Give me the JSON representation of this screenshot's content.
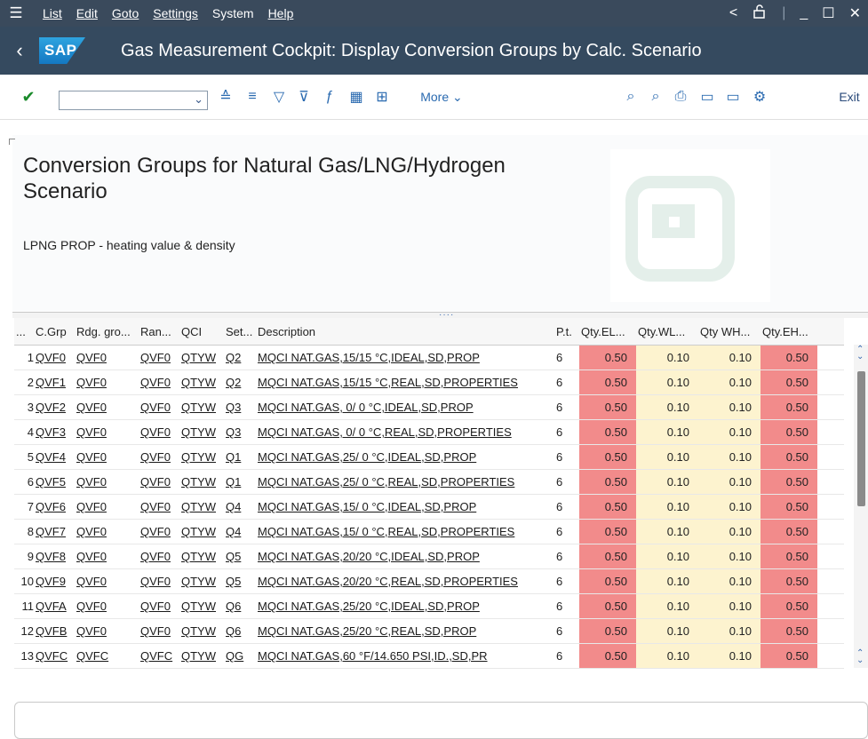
{
  "menubar": {
    "items": [
      "List",
      "Edit",
      "Goto",
      "Settings",
      "System",
      "Help"
    ]
  },
  "title": "Gas Measurement Cockpit: Display Conversion Groups by Calc. Scenario",
  "logo_text": "SAP",
  "toolbar": {
    "more_label": "More",
    "exit_label": "Exit"
  },
  "content": {
    "heading": "Conversion Groups for Natural Gas/LNG/Hydrogen Scenario",
    "subheading": "LPNG PROP - heating value & density"
  },
  "table": {
    "columns": [
      "...",
      "C.Grp",
      "Rdg. gro...",
      "Ran...",
      "QCI",
      "Set...",
      "Description",
      "P.t.",
      "Qty.EL...",
      "Qty.WL...",
      "Qty WH...",
      "Qty.EH..."
    ],
    "rows": [
      {
        "n": "1",
        "grp": "QVF0",
        "rdg": "QVF0",
        "ran": "QVF0",
        "qci": "QTYW",
        "set": "Q2",
        "desc": "MQCI NAT.GAS,15/15 °C,IDEAL,SD,PROP",
        "pt": "6",
        "el": "0.50",
        "wl": "0.10",
        "wh": "0.10",
        "eh": "0.50"
      },
      {
        "n": "2",
        "grp": "QVF1",
        "rdg": "QVF0",
        "ran": "QVF0",
        "qci": "QTYW",
        "set": "Q2",
        "desc": "MQCI NAT.GAS,15/15 °C,REAL,SD,PROPERTIES",
        "pt": "6",
        "el": "0.50",
        "wl": "0.10",
        "wh": "0.10",
        "eh": "0.50"
      },
      {
        "n": "3",
        "grp": "QVF2",
        "rdg": "QVF0",
        "ran": "QVF0",
        "qci": "QTYW",
        "set": "Q3",
        "desc": "MQCI NAT.GAS, 0/ 0 °C,IDEAL,SD,PROP",
        "pt": "6",
        "el": "0.50",
        "wl": "0.10",
        "wh": "0.10",
        "eh": "0.50"
      },
      {
        "n": "4",
        "grp": "QVF3",
        "rdg": "QVF0",
        "ran": "QVF0",
        "qci": "QTYW",
        "set": "Q3",
        "desc": "MQCI NAT.GAS, 0/ 0 °C,REAL,SD,PROPERTIES",
        "pt": "6",
        "el": "0.50",
        "wl": "0.10",
        "wh": "0.10",
        "eh": "0.50"
      },
      {
        "n": "5",
        "grp": "QVF4",
        "rdg": "QVF0",
        "ran": "QVF0",
        "qci": "QTYW",
        "set": "Q1",
        "desc": "MQCI NAT.GAS,25/ 0 °C,IDEAL,SD,PROP",
        "pt": "6",
        "el": "0.50",
        "wl": "0.10",
        "wh": "0.10",
        "eh": "0.50"
      },
      {
        "n": "6",
        "grp": "QVF5",
        "rdg": "QVF0",
        "ran": "QVF0",
        "qci": "QTYW",
        "set": "Q1",
        "desc": "MQCI NAT.GAS,25/ 0 °C,REAL,SD,PROPERTIES",
        "pt": "6",
        "el": "0.50",
        "wl": "0.10",
        "wh": "0.10",
        "eh": "0.50"
      },
      {
        "n": "7",
        "grp": "QVF6",
        "rdg": "QVF0",
        "ran": "QVF0",
        "qci": "QTYW",
        "set": "Q4",
        "desc": "MQCI NAT.GAS,15/ 0 °C,IDEAL,SD,PROP",
        "pt": "6",
        "el": "0.50",
        "wl": "0.10",
        "wh": "0.10",
        "eh": "0.50"
      },
      {
        "n": "8",
        "grp": "QVF7",
        "rdg": "QVF0",
        "ran": "QVF0",
        "qci": "QTYW",
        "set": "Q4",
        "desc": "MQCI NAT.GAS,15/ 0 °C,REAL,SD,PROPERTIES",
        "pt": "6",
        "el": "0.50",
        "wl": "0.10",
        "wh": "0.10",
        "eh": "0.50"
      },
      {
        "n": "9",
        "grp": "QVF8",
        "rdg": "QVF0",
        "ran": "QVF0",
        "qci": "QTYW",
        "set": "Q5",
        "desc": "MQCI NAT.GAS,20/20 °C,IDEAL,SD,PROP",
        "pt": "6",
        "el": "0.50",
        "wl": "0.10",
        "wh": "0.10",
        "eh": "0.50"
      },
      {
        "n": "10",
        "grp": "QVF9",
        "rdg": "QVF0",
        "ran": "QVF0",
        "qci": "QTYW",
        "set": "Q5",
        "desc": "MQCI NAT.GAS,20/20 °C,REAL,SD,PROPERTIES",
        "pt": "6",
        "el": "0.50",
        "wl": "0.10",
        "wh": "0.10",
        "eh": "0.50"
      },
      {
        "n": "11",
        "grp": "QVFA",
        "rdg": "QVF0",
        "ran": "QVF0",
        "qci": "QTYW",
        "set": "Q6",
        "desc": "MQCI NAT.GAS,25/20 °C,IDEAL,SD,PROP",
        "pt": "6",
        "el": "0.50",
        "wl": "0.10",
        "wh": "0.10",
        "eh": "0.50"
      },
      {
        "n": "12",
        "grp": "QVFB",
        "rdg": "QVF0",
        "ran": "QVF0",
        "qci": "QTYW",
        "set": "Q6",
        "desc": "MQCI NAT.GAS,25/20 °C,REAL,SD,PROP",
        "pt": "6",
        "el": "0.50",
        "wl": "0.10",
        "wh": "0.10",
        "eh": "0.50"
      },
      {
        "n": "13",
        "grp": "QVFC",
        "rdg": "QVFC",
        "ran": "QVFC",
        "qci": "QTYW",
        "set": "QG",
        "desc": "MQCI NAT.GAS,60 °F/14.650 PSI,ID.,SD,PR",
        "pt": "6",
        "el": "0.50",
        "wl": "0.10",
        "wh": "0.10",
        "eh": "0.50"
      }
    ]
  },
  "colors": {
    "shell": "#354a5f",
    "menubar": "#3a4a5c",
    "red_cell": "#f28b8b",
    "yellow_cell": "#fdf3cf",
    "accent": "#2a6ab0"
  },
  "icons": [
    "menu-icon",
    "back-icon",
    "check-icon",
    "sort-ascending-icon",
    "sort-descending-icon",
    "filter-icon",
    "filter-settings-icon",
    "formula-icon",
    "grid-icon",
    "export-icon",
    "search-icon",
    "search-next-icon",
    "print-icon",
    "layout-icon",
    "layout-save-icon",
    "settings-icon",
    "lock-icon",
    "minimize-icon",
    "maximize-icon",
    "close-icon"
  ]
}
